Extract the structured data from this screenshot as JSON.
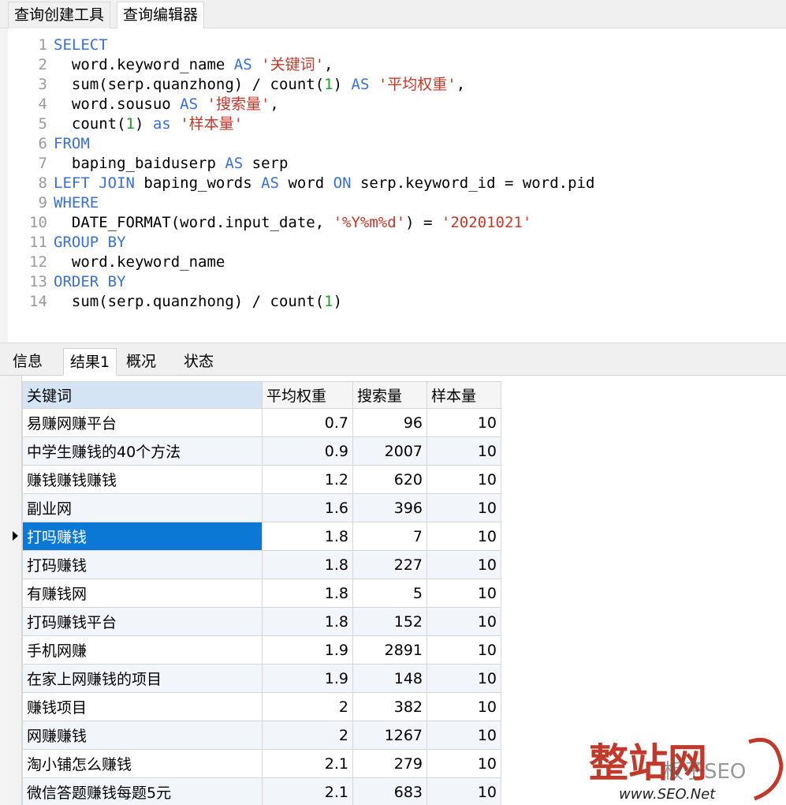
{
  "top_tabs": [
    {
      "label": "查询创建工具",
      "active": false
    },
    {
      "label": "查询编辑器",
      "active": true
    }
  ],
  "editor": {
    "lines": [
      {
        "n": "1",
        "tokens": [
          [
            "kw",
            "SELECT"
          ]
        ]
      },
      {
        "n": "2",
        "tokens": [
          [
            "",
            "  word.keyword_name "
          ],
          [
            "kw",
            "AS"
          ],
          [
            "",
            " "
          ],
          [
            "str",
            "'关键词'"
          ],
          [
            "",
            ","
          ]
        ]
      },
      {
        "n": "3",
        "tokens": [
          [
            "",
            "  sum(serp.quanzhong) / count("
          ],
          [
            "num",
            "1"
          ],
          [
            "",
            ") "
          ],
          [
            "kw",
            "AS"
          ],
          [
            "",
            " "
          ],
          [
            "str",
            "'平均权重'"
          ],
          [
            "",
            ","
          ]
        ]
      },
      {
        "n": "4",
        "tokens": [
          [
            "",
            "  word.sousuo "
          ],
          [
            "kw",
            "AS"
          ],
          [
            "",
            " "
          ],
          [
            "str",
            "'搜索量'"
          ],
          [
            "",
            ","
          ]
        ]
      },
      {
        "n": "5",
        "tokens": [
          [
            "",
            "  count("
          ],
          [
            "num",
            "1"
          ],
          [
            "",
            ") "
          ],
          [
            "kw",
            "as"
          ],
          [
            "",
            " "
          ],
          [
            "str",
            "'样本量'"
          ]
        ]
      },
      {
        "n": "6",
        "tokens": [
          [
            "kw",
            "FROM"
          ]
        ]
      },
      {
        "n": "7",
        "tokens": [
          [
            "",
            "  baping_baiduserp "
          ],
          [
            "kw",
            "AS"
          ],
          [
            "",
            " serp"
          ]
        ]
      },
      {
        "n": "8",
        "tokens": [
          [
            "kw",
            "LEFT JOIN"
          ],
          [
            "",
            " baping_words "
          ],
          [
            "kw",
            "AS"
          ],
          [
            "",
            " word "
          ],
          [
            "kw",
            "ON"
          ],
          [
            "",
            " serp.keyword_id = word.pid"
          ]
        ]
      },
      {
        "n": "9",
        "tokens": [
          [
            "kw",
            "WHERE"
          ]
        ]
      },
      {
        "n": "10",
        "tokens": [
          [
            "",
            "  DATE_FORMAT(word.input_date, "
          ],
          [
            "str",
            "'%Y%m%d'"
          ],
          [
            "",
            ") = "
          ],
          [
            "str",
            "'20201021'"
          ]
        ]
      },
      {
        "n": "11",
        "tokens": [
          [
            "kw",
            "GROUP BY"
          ]
        ]
      },
      {
        "n": "12",
        "tokens": [
          [
            "",
            "  word.keyword_name"
          ]
        ]
      },
      {
        "n": "13",
        "tokens": [
          [
            "kw",
            "ORDER BY"
          ]
        ]
      },
      {
        "n": "14",
        "tokens": [
          [
            "",
            "  sum(serp.quanzhong) / count("
          ],
          [
            "num",
            "1"
          ],
          [
            "",
            ")"
          ]
        ]
      }
    ]
  },
  "bottom_tabs": [
    {
      "label": "信息",
      "active": false
    },
    {
      "label": "结果1",
      "active": true
    },
    {
      "label": "概况",
      "active": false
    },
    {
      "label": "状态",
      "active": false
    }
  ],
  "result": {
    "columns": [
      "关键词",
      "平均权重",
      "搜索量",
      "样本量"
    ],
    "rows": [
      [
        "易赚网赚平台",
        "0.7",
        "96",
        "10"
      ],
      [
        "中学生赚钱的40个方法",
        "0.9",
        "2007",
        "10"
      ],
      [
        "赚钱赚钱赚钱",
        "1.2",
        "620",
        "10"
      ],
      [
        "副业网",
        "1.6",
        "396",
        "10"
      ],
      [
        "打吗赚钱",
        "1.8",
        "7",
        "10"
      ],
      [
        "打码赚钱",
        "1.8",
        "227",
        "10"
      ],
      [
        "有赚钱网",
        "1.8",
        "5",
        "10"
      ],
      [
        "打码赚钱平台",
        "1.8",
        "152",
        "10"
      ],
      [
        "手机网赚",
        "1.9",
        "2891",
        "10"
      ],
      [
        "在家上网赚钱的项目",
        "1.9",
        "148",
        "10"
      ],
      [
        "赚钱项目",
        "2",
        "382",
        "10"
      ],
      [
        "网赚赚钱",
        "2",
        "1267",
        "10"
      ],
      [
        "淘小铺怎么赚钱",
        "2.1",
        "279",
        "10"
      ],
      [
        "微信答题赚钱每题5元",
        "2.1",
        "683",
        "10"
      ]
    ],
    "selected_row": 4
  },
  "watermark": {
    "big_text": "整站网",
    "site": "www.SEO.Net",
    "overlay": "板子SEO",
    "colors": {
      "red": "#c0392b"
    }
  },
  "colors": {
    "keyword": "#3b6fd6",
    "string": "#c0392b",
    "number": "#1f9f1f",
    "selection": "#0b78d6"
  }
}
